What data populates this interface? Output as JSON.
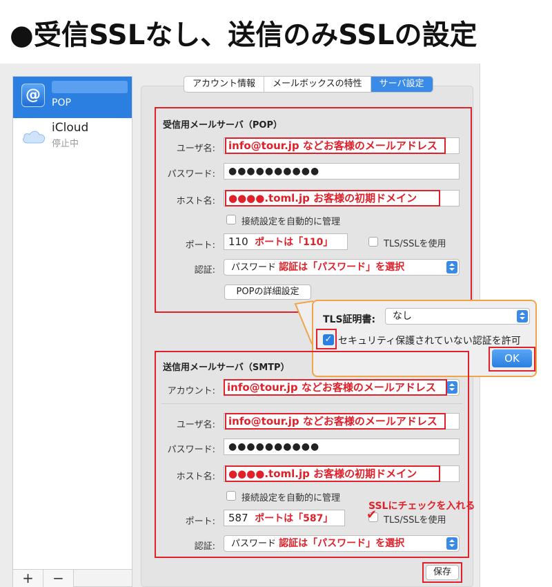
{
  "banner": {
    "title": "●受信SSLなし、送信のみSSLの設定"
  },
  "sidebar": {
    "accounts": [
      {
        "name": "",
        "type": "POP",
        "icon": "at-sign-icon"
      },
      {
        "name": "iCloud",
        "status": "停止中",
        "icon": "cloud-icon"
      }
    ],
    "add_label": "+",
    "remove_label": "−"
  },
  "tabs": [
    {
      "label": "アカウント情報",
      "active": false
    },
    {
      "label": "メールボックスの特性",
      "active": false
    },
    {
      "label": "サーバ設定",
      "active": true
    }
  ],
  "incoming": {
    "title": "受信用メールサーバ（POP）",
    "username_label": "ユーザ名:",
    "username_value": "info@tour.jp などお客様のメールアドレス",
    "password_label": "パスワード:",
    "password_value": "●●●●●●●●●●",
    "host_label": "ホスト名:",
    "host_value": "●●●●.toml.jp  お客様の初期ドメイン",
    "auto_manage_label": "接続設定を自動的に管理",
    "port_label": "ポート:",
    "port_value": "110",
    "port_note": "ポートは「110」",
    "tls_label": "TLS/SSLを使用",
    "auth_label": "認証:",
    "auth_value": "パスワード",
    "auth_note": "認証は「パスワード」を選択",
    "details_button": "POPの詳細設定"
  },
  "popup": {
    "cert_label": "TLS証明書:",
    "cert_value": "なし",
    "allow_insecure_label": "セキュリティ保護されていない認証を許可",
    "allow_insecure_checked": true,
    "ok_label": "OK"
  },
  "outgoing": {
    "title": "送信用メールサーバ（SMTP）",
    "account_label": "アカウント:",
    "account_value": "info@tour.jp などお客様のメールアドレス",
    "username_label": "ユーザ名:",
    "username_value": "info@tour.jp などお客様のメールアドレス",
    "password_label": "パスワード:",
    "password_value": "●●●●●●●●●●",
    "host_label": "ホスト名:",
    "host_value": "●●●●.toml.jp  お客様の初期ドメイン",
    "auto_manage_label": "接続設定を自動的に管理",
    "port_label": "ポート:",
    "port_value": "587",
    "port_note": "ポートは「587」",
    "ssl_annotation": "SSLにチェックを入れる",
    "tls_label": "TLS/SSLを使用",
    "tls_checked": true,
    "auth_label": "認証:",
    "auth_value": "パスワード",
    "auth_note": "認証は「パスワード」を選択"
  },
  "save_label": "保存",
  "colors": {
    "highlight": "#e0202a",
    "accent": "#2a7fe0",
    "popup_border": "#f0a44a"
  }
}
